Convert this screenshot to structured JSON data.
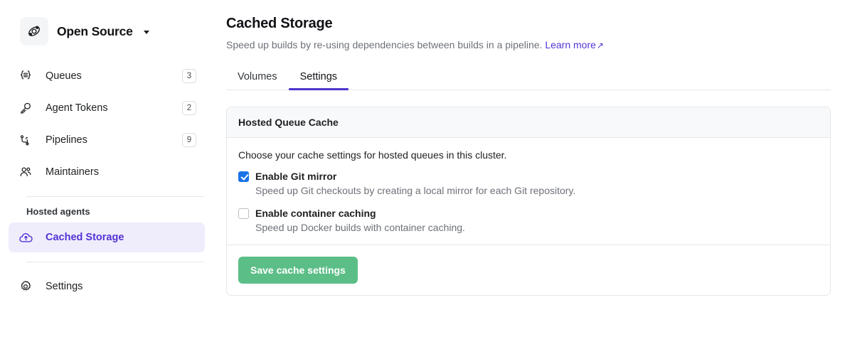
{
  "sidebar": {
    "org": {
      "name": "Open Source",
      "logo_icon": "orbit-icon",
      "caret_icon": "chevron-down-icon"
    },
    "items": [
      {
        "label": "Queues",
        "badge": "3",
        "icon": "queues-icon"
      },
      {
        "label": "Agent Tokens",
        "badge": "2",
        "icon": "key-icon"
      },
      {
        "label": "Pipelines",
        "badge": "9",
        "icon": "pipeline-icon"
      },
      {
        "label": "Maintainers",
        "badge": "",
        "icon": "people-icon"
      }
    ],
    "section_title": "Hosted agents",
    "hosted_items": [
      {
        "label": "Cached Storage",
        "icon": "cloud-upload-icon",
        "active": true
      }
    ],
    "footer_items": [
      {
        "label": "Settings",
        "icon": "gear-icon"
      }
    ]
  },
  "main": {
    "title": "Cached Storage",
    "subtitle": "Speed up builds by re-using dependencies between builds in a pipeline.",
    "learn_more": "Learn more",
    "learn_more_icon": "↗",
    "tabs": [
      {
        "label": "Volumes",
        "active": false
      },
      {
        "label": "Settings",
        "active": true
      }
    ],
    "card": {
      "header": "Hosted Queue Cache",
      "intro": "Choose your cache settings for hosted queues in this cluster.",
      "options": [
        {
          "label": "Enable Git mirror",
          "description": "Speed up Git checkouts by creating a local mirror for each Git repository.",
          "checked": true
        },
        {
          "label": "Enable container caching",
          "description": "Speed up Docker builds with container caching.",
          "checked": false
        }
      ],
      "save_label": "Save cache settings"
    }
  },
  "colors": {
    "accent_purple": "#5433d6",
    "tab_underline": "#4f33cc",
    "checkbox_blue": "#1a73e8",
    "save_green": "#5cbe87",
    "active_nav_bg": "#efedfc"
  }
}
